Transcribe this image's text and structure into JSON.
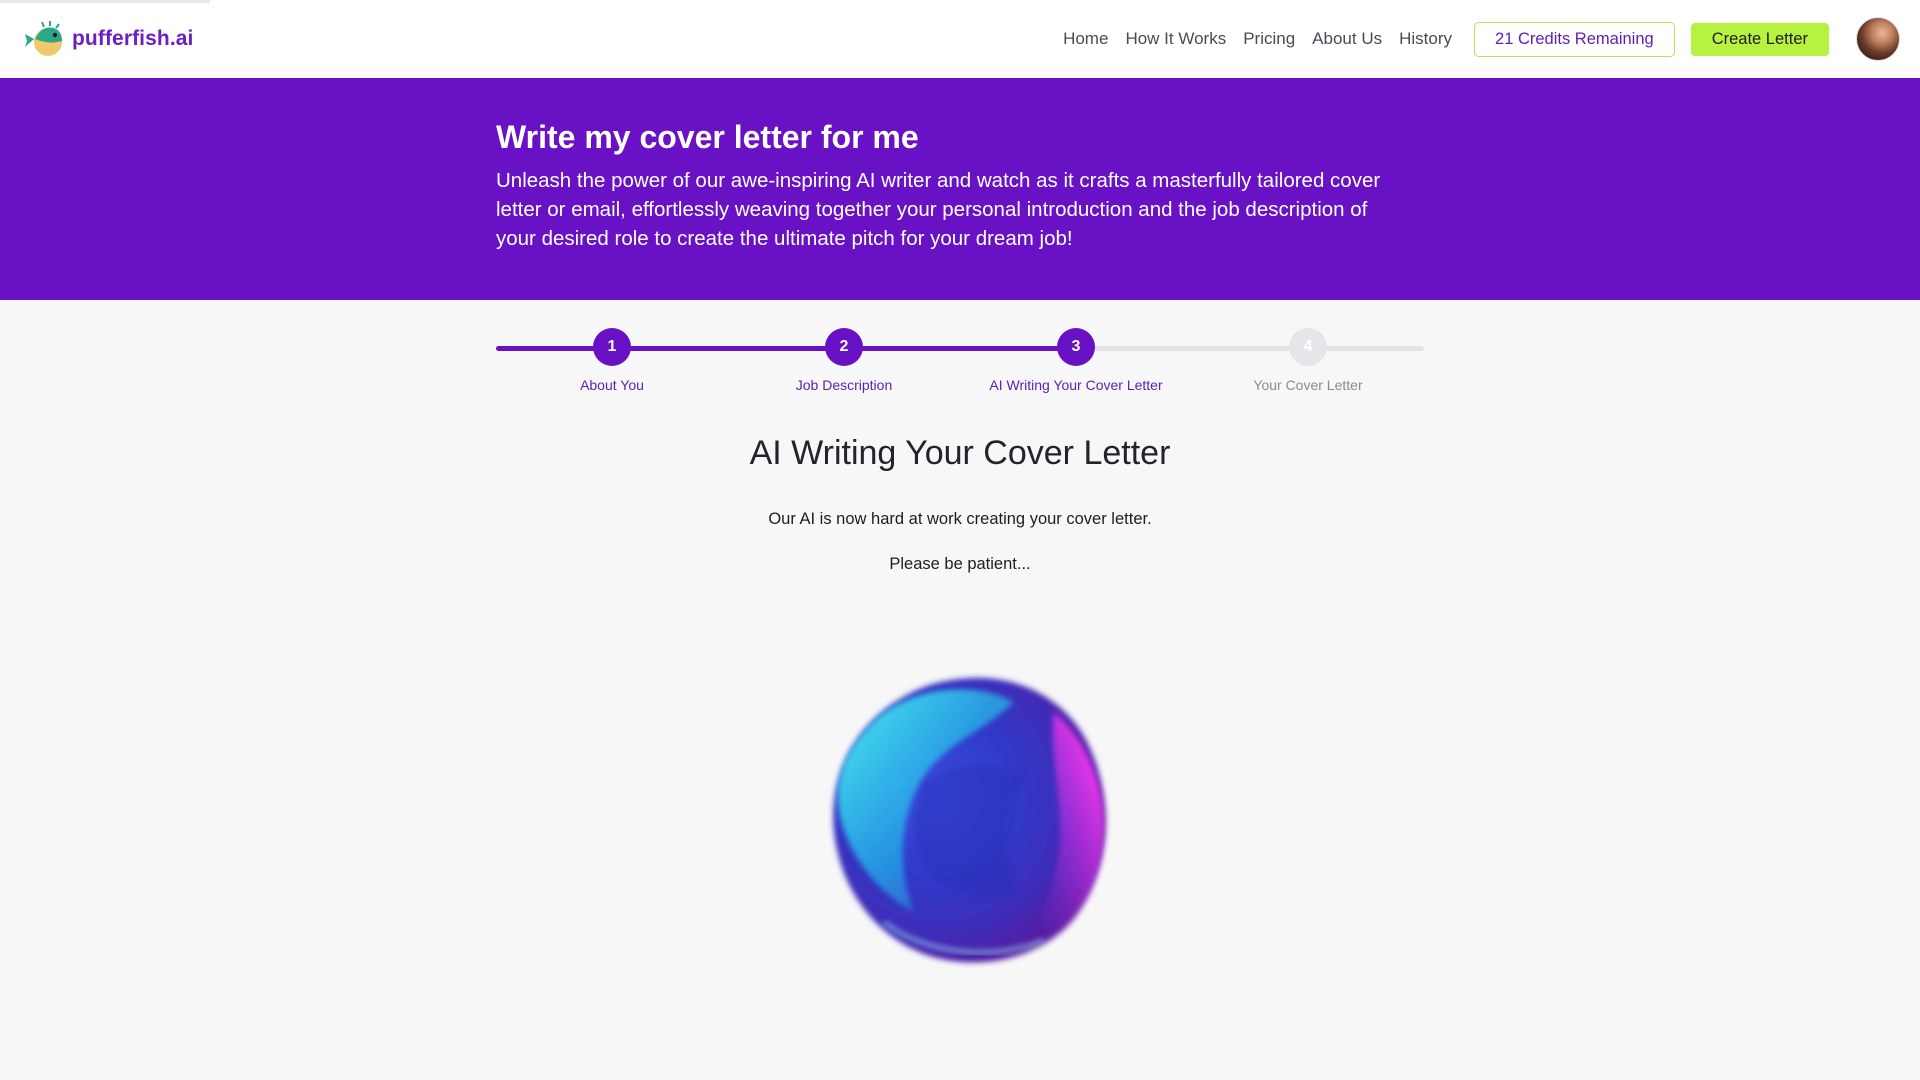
{
  "navbar": {
    "brand_name": "pufferfish.ai",
    "logo_icon": "pufferfish-logo-icon",
    "links": [
      "Home",
      "How It Works",
      "Pricing",
      "About Us",
      "History"
    ],
    "credits_label": "21 Credits Remaining",
    "create_label": "Create Letter",
    "avatar_icon": "user-avatar"
  },
  "hero": {
    "title": "Write my cover letter for me",
    "description": "Unleash the power of our awe-inspiring AI writer and watch as it crafts a masterfully tailored cover letter or email, effortlessly weaving together your personal introduction and the job description of your desired role to create the ultimate pitch for your dream job!"
  },
  "stepper": {
    "current_step": 3,
    "steps": [
      {
        "number": "1",
        "label": "About You"
      },
      {
        "number": "2",
        "label": "Job Description"
      },
      {
        "number": "3",
        "label": "AI Writing Your Cover Letter"
      },
      {
        "number": "4",
        "label": "Your Cover Letter"
      }
    ]
  },
  "main": {
    "title": "AI Writing Your Cover Letter",
    "line1": "Our AI is now hard at work creating your cover letter.",
    "line2": "Please be patient...",
    "animation_icon": "ai-orb-animation"
  },
  "colors": {
    "brand_purple": "#6811c5",
    "accent_lime": "#b6f23f",
    "inactive_grey": "#e6e6ea",
    "page_bg": "#f7f7f8"
  }
}
